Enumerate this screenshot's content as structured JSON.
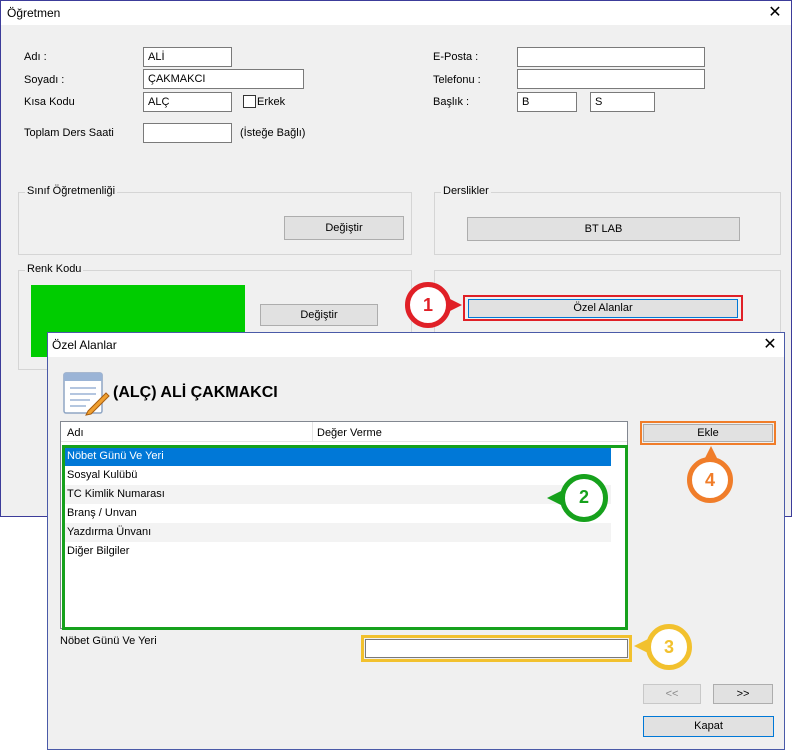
{
  "main_window": {
    "title": "Öğretmen",
    "labels": {
      "name": "Adı :",
      "surname": "Soyadı :",
      "short_code": "Kısa Kodu",
      "total_hours": "Toplam Ders Saati",
      "optional": "(İsteğe Bağlı)",
      "email": "E-Posta :",
      "phone": "Telefonu :",
      "title": "Başlık :"
    },
    "fields": {
      "name": "ALİ",
      "surname": "ÇAKMAKCI",
      "short_code": "ALÇ",
      "total_hours": "",
      "email": "",
      "phone": "",
      "title_start": "B",
      "title_end": "S"
    },
    "male_checkbox_label": "Erkek",
    "male_checked": false,
    "class_teacher_group": {
      "title": "Sınıf Öğretmenliği",
      "button": "Değiştir"
    },
    "courses_group": {
      "title": "Derslikler",
      "button": "BT LAB"
    },
    "color_group": {
      "title": "Renk Kodu",
      "color": "#00cc00",
      "button": "Değiştir"
    },
    "custom_fields_button": "Özel Alanlar"
  },
  "dialog": {
    "title": "Özel Alanlar",
    "header": "(ALÇ) ALİ ÇAKMAKCI",
    "columns": [
      "Adı",
      "Değer Verme"
    ],
    "items": [
      "Nöbet Günü Ve Yeri",
      "Sosyal Kulübü",
      "TC Kimlik Numarası",
      "Branş / Unvan",
      "Yazdırma Ünvanı",
      "Diğer Bilgiler"
    ],
    "selected_index": 0,
    "add_button": "Ekle",
    "field_label": "Nöbet Günü Ve Yeri",
    "field_value": "",
    "prev_button": "<<",
    "next_button": ">>",
    "close_button": "Kapat"
  },
  "annotations": {
    "badge1": "1",
    "badge2": "2",
    "badge3": "3",
    "badge4": "4",
    "colors": {
      "red": "#e02027",
      "green": "#16a11c",
      "yellow": "#f2c12e",
      "orange": "#f07d2a"
    }
  }
}
